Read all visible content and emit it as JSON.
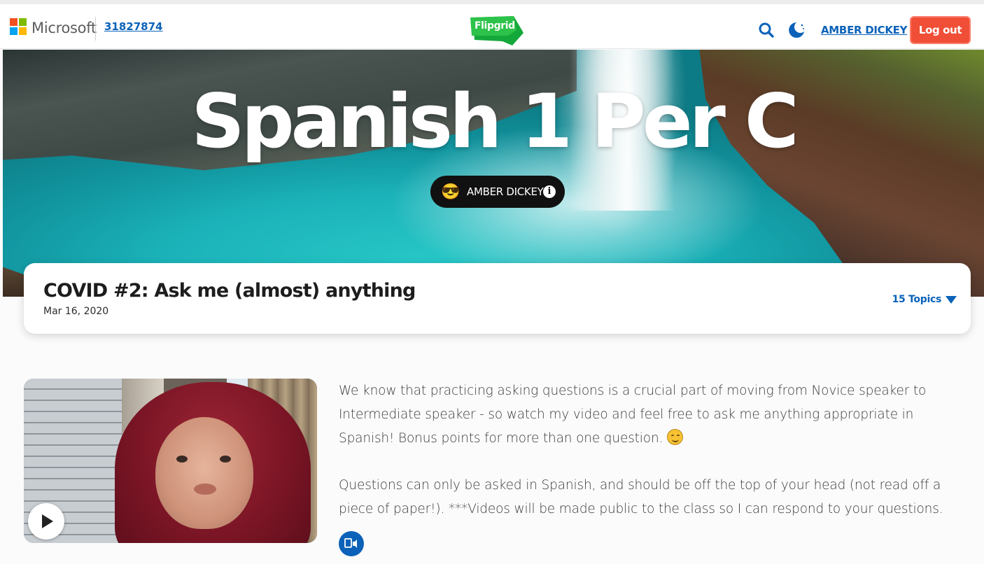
{
  "header": {
    "brand": "Microsoft",
    "join_code": "31827874",
    "logo_text": "Flipgrid",
    "user_name": "AMBER DICKEY",
    "logout_label": "Log out",
    "icons": [
      "search-icon",
      "moon-icon"
    ],
    "colors": {
      "link": "#0b62b8",
      "logout": "#f04e36",
      "flipgrid_green": "#2dc24a"
    }
  },
  "banner": {
    "title": "Spanish 1 Per C",
    "owner_emoji": "😎",
    "owner_name": "AMBER DICKEY"
  },
  "topic": {
    "title": "COVID #2: Ask me (almost) anything",
    "date": "Mar 16, 2020",
    "topics_toggle": "15 Topics"
  },
  "description": {
    "paragraph_1": "We know that practicing asking questions is a crucial part of moving from Novice speaker to Intermediate speaker - so watch my video and feel free to ask me anything appropriate in Spanish! Bonus points for more than one question.",
    "paragraph_2": "Questions can only be asked in Spanish, and should be off the top of your head (not read off a piece of paper!). ***Videos will be made public to the class so I can respond to your questions."
  }
}
